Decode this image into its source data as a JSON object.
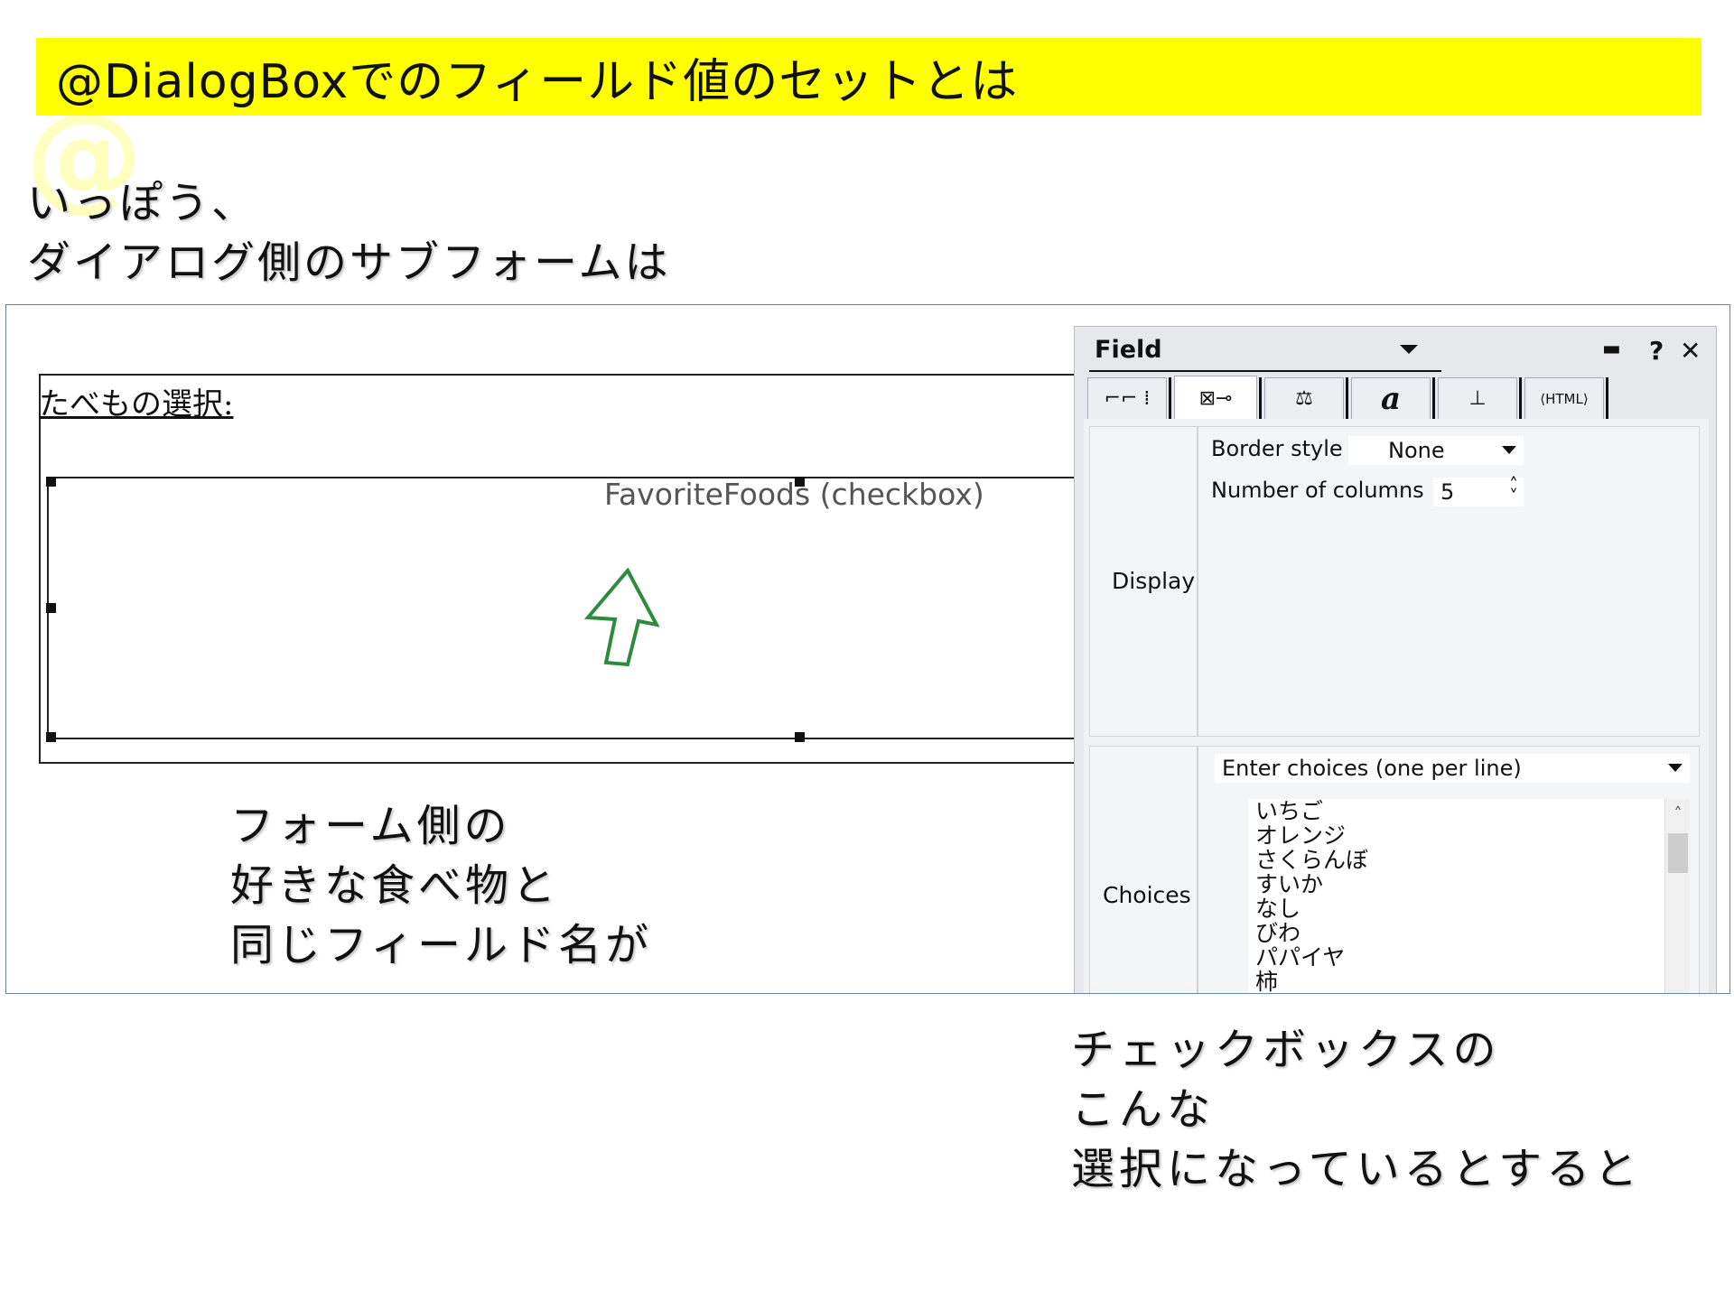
{
  "slide": {
    "title": "@DialogBoxでのフィールド値のセットとは",
    "watermark": "@",
    "intro_lines": [
      "いっぽう、",
      "ダイアログ側のサブフォームは"
    ],
    "form_note_lines": [
      "フォーム側の",
      "好きな食べ物と",
      "同じフィールド名が"
    ],
    "bottom_note_lines": [
      "チェックボックスの",
      "こんな",
      "選択になっているとすると"
    ]
  },
  "form": {
    "label": "たべもの選択:",
    "field_caption": "FavoriteFoods (checkbox)"
  },
  "panel": {
    "title": "Field",
    "controls": {
      "pin": "▬",
      "help": "?",
      "close": "✕"
    },
    "tabs": [
      {
        "label": "⌐⌐ ⁞",
        "icon": "basics-tab-icon"
      },
      {
        "label": "⊠⊸",
        "icon": "control-tab-icon"
      },
      {
        "label": "⚖",
        "icon": "advanced-tab-icon"
      },
      {
        "label": "a",
        "icon": "font-tab-icon"
      },
      {
        "label": "⊥",
        "icon": "paragraph-tab-icon"
      },
      {
        "label": "⟨HTML⟩",
        "icon": "html-tab-icon"
      }
    ],
    "display": {
      "section_title": "Display",
      "border_style_label": "Border style",
      "border_style_value": "None",
      "columns_label": "Number of columns",
      "columns_value": "5"
    },
    "choices": {
      "section_title": "Choices",
      "source": "Enter choices (one per line)",
      "items": [
        "いちご",
        "オレンジ",
        "さくらんぼ",
        "すいか",
        "なし",
        "びわ",
        "パパイヤ",
        "柿"
      ]
    }
  },
  "colors": {
    "title_band": "#ffff00",
    "arrow": "#2e8b3e",
    "frame": "#6b82a8"
  }
}
